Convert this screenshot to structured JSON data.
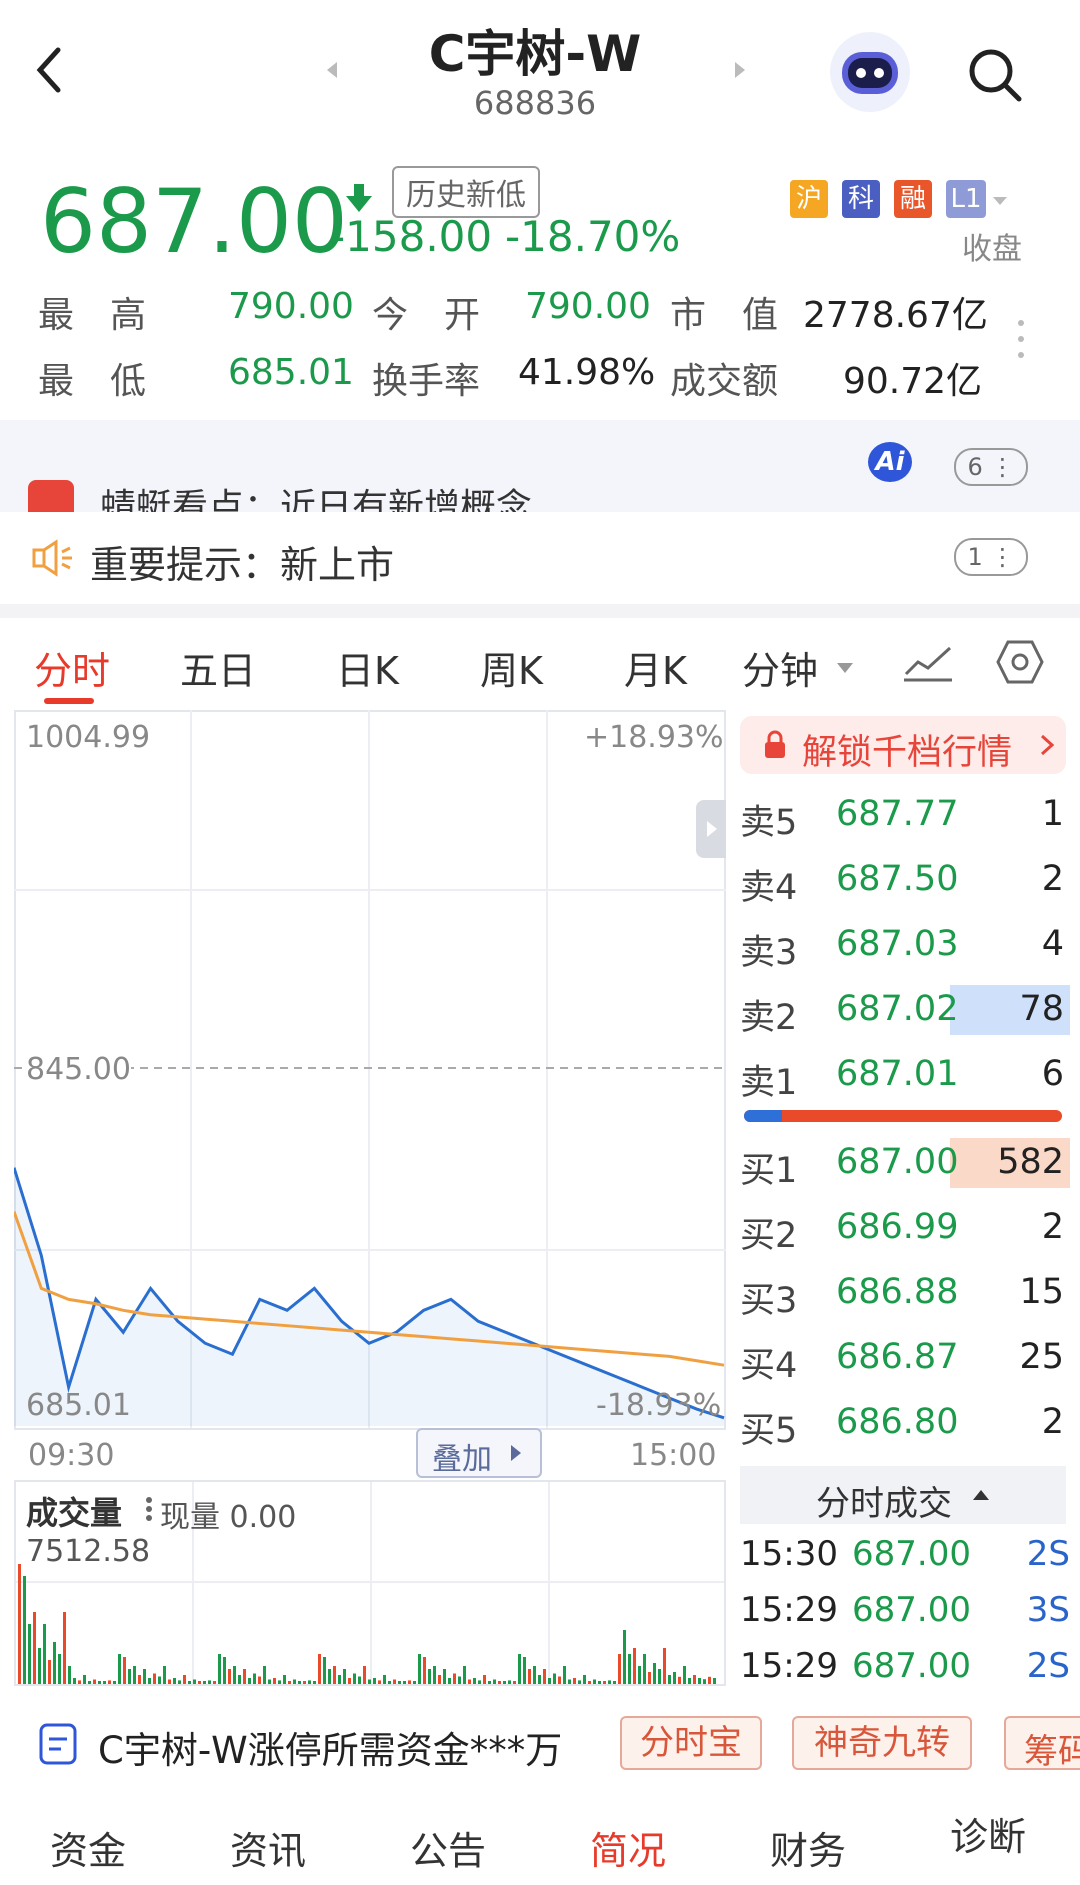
{
  "header": {
    "title": "C宇树-W",
    "code": "688836"
  },
  "quote": {
    "price": "687.00",
    "change": "-158.00",
    "change_pct": "-18.70%",
    "history_badge": "历史新低",
    "tags": [
      "沪",
      "科",
      "融",
      "L1"
    ],
    "status": "收盘",
    "stats": [
      {
        "label": "最　高",
        "value": "790.00"
      },
      {
        "label": "今　开",
        "value": "790.00"
      },
      {
        "label": "市　值",
        "value": "2778.67亿"
      },
      {
        "label": "最　低",
        "value": "685.01"
      },
      {
        "label": "换手率",
        "value": "41.98%"
      },
      {
        "label": "成交额",
        "value": "90.72亿"
      }
    ]
  },
  "banner": {
    "ai_badge": "Ai",
    "hint_count": "6",
    "cut_text": "蜻蜓看点：近日有新增概念",
    "notice": "重要提示：新上市",
    "notice_count": "1"
  },
  "tabs": [
    "分时",
    "五日",
    "日K",
    "周K",
    "月K",
    "分钟"
  ],
  "active_tab": "分时",
  "chart": {
    "top_price": "1004.99",
    "top_pct": "+18.93%",
    "mid_price": "845.00",
    "bottom_price": "685.01",
    "bottom_pct": "-18.93%",
    "time_start": "09:30",
    "time_end": "15:00",
    "overlay_button": "叠加",
    "volume_title": "成交量",
    "volume_now": "现量 0.00",
    "volume_max": "7512.58"
  },
  "chart_data": {
    "type": "line",
    "ylim": [
      685.01,
      1004.99
    ],
    "prev_close": 845.0,
    "series": [
      {
        "values": [
          800,
          760,
          700,
          740,
          725,
          745,
          730,
          720,
          715,
          740,
          735,
          745,
          730,
          720,
          725,
          735,
          740,
          730,
          725,
          720,
          715,
          710,
          705,
          700,
          695,
          690,
          686
        ]
      },
      {
        "values": [
          780,
          745,
          740,
          738,
          735,
          733,
          732,
          731,
          730,
          729,
          728,
          727,
          726,
          725,
          724,
          723,
          722,
          721,
          720,
          719,
          718,
          717,
          716,
          715,
          714,
          712,
          710
        ]
      }
    ]
  },
  "orderbook": {
    "unlock": "解锁千档行情",
    "asks": [
      {
        "label": "卖5",
        "price": "687.77",
        "vol": "1"
      },
      {
        "label": "卖4",
        "price": "687.50",
        "vol": "2"
      },
      {
        "label": "卖3",
        "price": "687.03",
        "vol": "4"
      },
      {
        "label": "卖2",
        "price": "687.02",
        "vol": "78"
      },
      {
        "label": "卖1",
        "price": "687.01",
        "vol": "6"
      }
    ],
    "bids": [
      {
        "label": "买1",
        "price": "687.00",
        "vol": "582"
      },
      {
        "label": "买2",
        "price": "686.99",
        "vol": "2"
      },
      {
        "label": "买3",
        "price": "686.88",
        "vol": "15"
      },
      {
        "label": "买4",
        "price": "686.87",
        "vol": "25"
      },
      {
        "label": "买5",
        "price": "686.80",
        "vol": "2"
      }
    ],
    "ticks_title": "分时成交",
    "ticks": [
      {
        "time": "15:30",
        "price": "687.00",
        "vol": "2S"
      },
      {
        "time": "15:29",
        "price": "687.00",
        "vol": "3S"
      },
      {
        "time": "15:29",
        "price": "687.00",
        "vol": "2S"
      }
    ]
  },
  "bottom_banner": {
    "text": "C宇树-W涨停所需资金***万",
    "buttons": [
      "分时宝",
      "神奇九转",
      "筹码"
    ]
  },
  "bottom_tabs": [
    "资金",
    "资讯",
    "公告",
    "简况",
    "财务",
    "诊断"
  ],
  "active_bottom_tab": "简况",
  "colors": {
    "down": "#1a9a4a",
    "active": "#e83a2a",
    "price_line": "#2a6fcf",
    "avg_line": "#f0a040"
  }
}
